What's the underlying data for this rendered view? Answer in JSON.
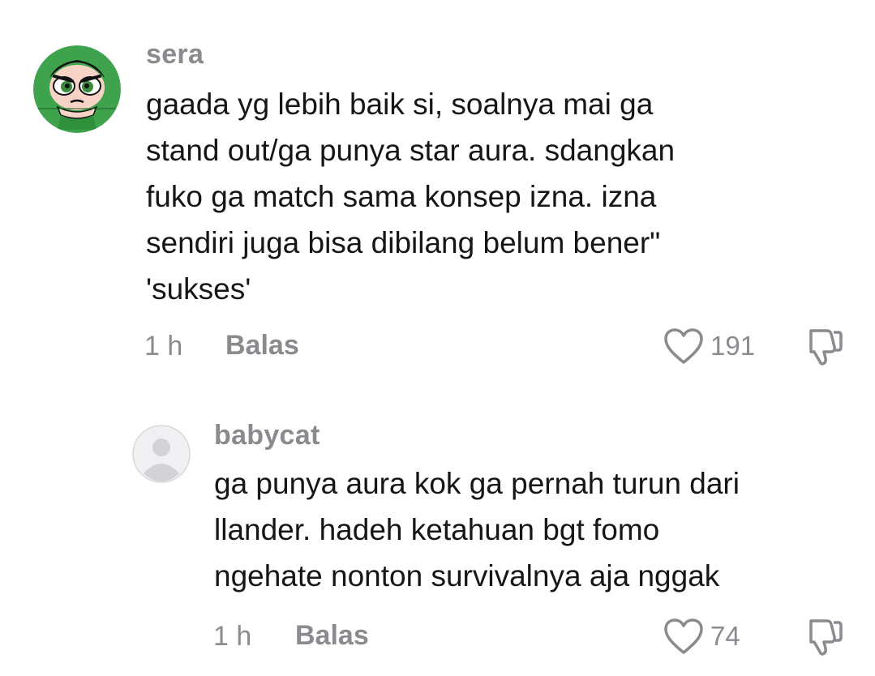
{
  "comments": [
    {
      "username": "sera",
      "text": "gaada yg lebih baik si, soalnya mai ga\nstand out/ga punya star aura. sdangkan\nfuko ga match sama konsep izna. izna\nsendiri juga bisa dibilang belum bener\"\n'sukses'",
      "time": "1 h",
      "reply_label": "Balas",
      "like_count": "191",
      "avatar_icon": "powerpuff-buttercup-avatar-icon"
    },
    {
      "username": "babycat",
      "text": "ga punya aura kok ga pernah turun dari\nllander. hadeh ketahuan bgt fomo\nngehate nonton survivalnya aja nggak",
      "time": "1 h",
      "reply_label": "Balas",
      "like_count": "74",
      "avatar_icon": "default-user-avatar-icon"
    }
  ],
  "colors": {
    "muted": "#8a8a8f",
    "text": "#161616",
    "avatar_green": "#3fa34d"
  }
}
